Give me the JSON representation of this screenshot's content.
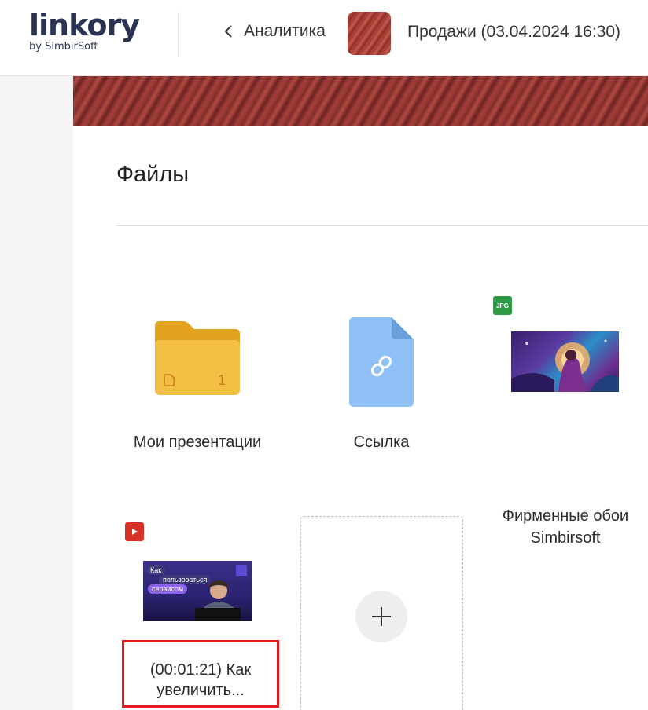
{
  "header": {
    "logo_main": "linkory",
    "logo_sub": "by SimbirSoft",
    "back_label": "Аналитика",
    "space_title": "Продажи (03.04.2024 16:30)"
  },
  "section": {
    "title": "Файлы"
  },
  "files": [
    {
      "name": "Мои презентации",
      "type": "folder",
      "count": "1"
    },
    {
      "name": "Ссылка",
      "type": "link"
    },
    {
      "name_line1": "Фирменные обои",
      "name_line2": "Simbirsoft",
      "type": "image",
      "badge": "JPG"
    },
    {
      "name_line1": "(00:01:21) Как",
      "name_line2": "увеличить...",
      "type": "video",
      "thumb_text_1": "Как",
      "thumb_text_2": "пользоваться",
      "thumb_text_3": "сервисом"
    }
  ],
  "colors": {
    "accent_red": "#e31b1b",
    "folder": "#f3bf45",
    "link_file": "#8fc1f7"
  }
}
